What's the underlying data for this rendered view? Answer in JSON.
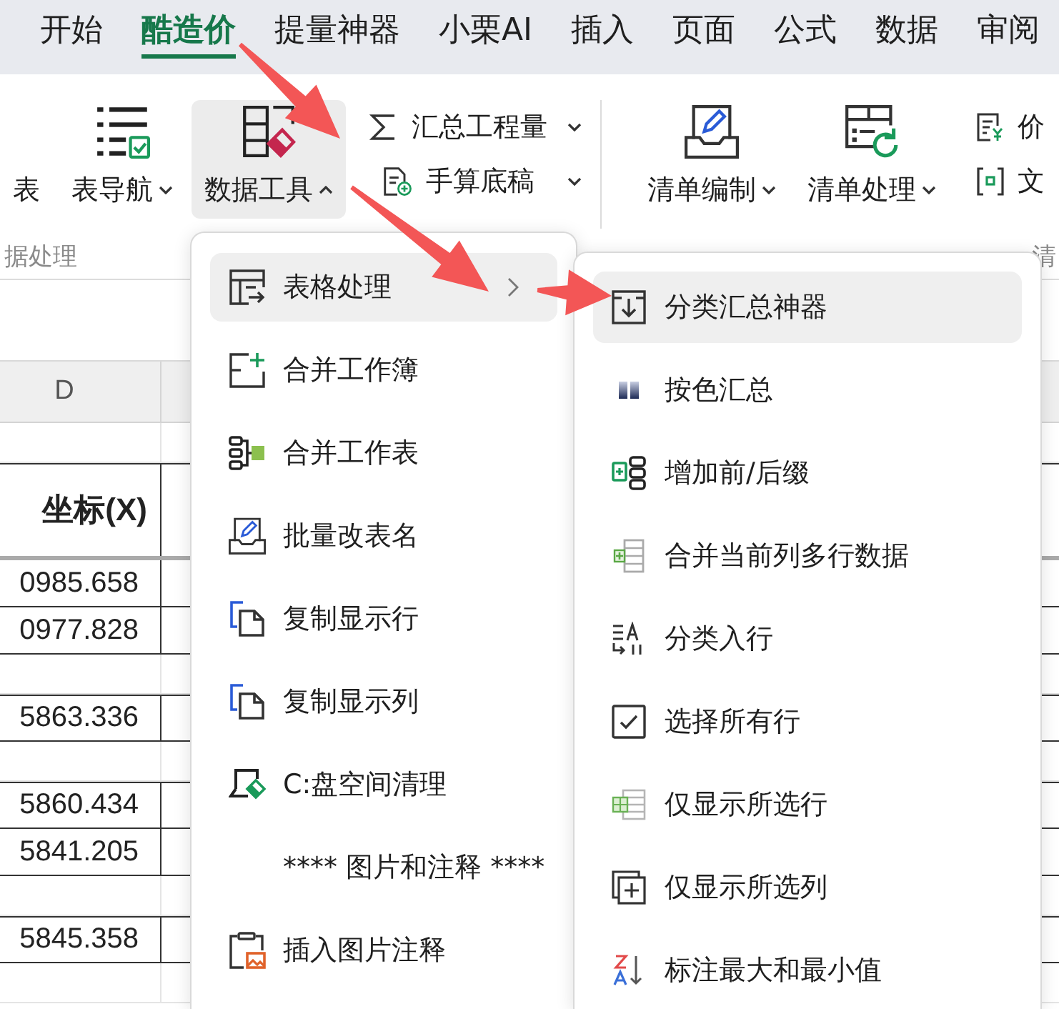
{
  "tabs": [
    {
      "label": "开始",
      "selected": false
    },
    {
      "label": "酷造价",
      "selected": true
    },
    {
      "label": "提量神器",
      "selected": false
    },
    {
      "label": "小栗AI",
      "selected": false
    },
    {
      "label": "插入",
      "selected": false
    },
    {
      "label": "页面",
      "selected": false
    },
    {
      "label": "公式",
      "selected": false
    },
    {
      "label": "数据",
      "selected": false
    },
    {
      "label": "审阅",
      "selected": false
    }
  ],
  "ribbon": {
    "groups": [
      {
        "label": "据处理",
        "buttons": [
          {
            "kind": "large",
            "label": "表",
            "dropdown": false,
            "expanded": false
          },
          {
            "kind": "large",
            "label": "表导航",
            "dropdown": true,
            "expanded": false
          },
          {
            "kind": "large",
            "label": "数据工具",
            "dropdown": true,
            "expanded": true
          },
          {
            "kind": "small",
            "label": "汇总工程量",
            "dropdown": true,
            "expanded": false
          },
          {
            "kind": "small",
            "label": "手算底稿",
            "dropdown": true,
            "expanded": false
          }
        ]
      },
      {
        "label": "清",
        "buttons": [
          {
            "kind": "large",
            "label": "清单编制",
            "dropdown": true,
            "expanded": false
          },
          {
            "kind": "large",
            "label": "清单处理",
            "dropdown": true,
            "expanded": false
          },
          {
            "kind": "small",
            "label": "价",
            "dropdown": false,
            "expanded": false
          },
          {
            "kind": "small",
            "label": "文",
            "dropdown": false,
            "expanded": false
          }
        ]
      }
    ]
  },
  "sheet": {
    "column_header": "D",
    "rows": [
      {
        "kind": "gap"
      },
      {
        "kind": "header",
        "cells": [
          "坐标(X)"
        ]
      },
      {
        "kind": "data",
        "cells": [
          "0985.658"
        ]
      },
      {
        "kind": "data",
        "cells": [
          "0977.828"
        ]
      },
      {
        "kind": "gap"
      },
      {
        "kind": "data",
        "cells": [
          "5863.336"
        ]
      },
      {
        "kind": "gap"
      },
      {
        "kind": "data",
        "cells": [
          "5860.434"
        ]
      },
      {
        "kind": "data",
        "cells": [
          "5841.205"
        ]
      },
      {
        "kind": "gap"
      },
      {
        "kind": "data",
        "cells": [
          "5845.358"
        ]
      },
      {
        "kind": "gap"
      }
    ]
  },
  "menus": [
    {
      "items": [
        {
          "kind": "item",
          "label": "表格处理",
          "selected": true,
          "submenu": true
        },
        {
          "kind": "item",
          "label": "合并工作簿",
          "selected": false,
          "submenu": false
        },
        {
          "kind": "item",
          "label": "合并工作表",
          "selected": false,
          "submenu": false
        },
        {
          "kind": "item",
          "label": "批量改表名",
          "selected": false,
          "submenu": false
        },
        {
          "kind": "item",
          "label": "复制显示行",
          "selected": false,
          "submenu": false
        },
        {
          "kind": "item",
          "label": "复制显示列",
          "selected": false,
          "submenu": false
        },
        {
          "kind": "item",
          "label": "C:盘空间清理",
          "selected": false,
          "submenu": false
        },
        {
          "kind": "section",
          "label": "**** 图片和注释 ****",
          "selected": false,
          "submenu": false
        },
        {
          "kind": "item",
          "label": "插入图片注释",
          "selected": false,
          "submenu": false
        }
      ]
    },
    {
      "items": [
        {
          "kind": "item",
          "label": "分类汇总神器",
          "selected": true,
          "submenu": false
        },
        {
          "kind": "item",
          "label": "按色汇总",
          "selected": false,
          "submenu": false
        },
        {
          "kind": "item",
          "label": "增加前/后缀",
          "selected": false,
          "submenu": false
        },
        {
          "kind": "item",
          "label": "合并当前列多行数据",
          "selected": false,
          "submenu": false
        },
        {
          "kind": "item",
          "label": "分类入行",
          "selected": false,
          "submenu": false
        },
        {
          "kind": "item",
          "label": "选择所有行",
          "selected": false,
          "submenu": false
        },
        {
          "kind": "item",
          "label": "仅显示所选行",
          "selected": false,
          "submenu": false
        },
        {
          "kind": "item",
          "label": "仅显示所选列",
          "selected": false,
          "submenu": false
        },
        {
          "kind": "item",
          "label": "标注最大和最小值",
          "selected": false,
          "submenu": false
        }
      ]
    }
  ]
}
